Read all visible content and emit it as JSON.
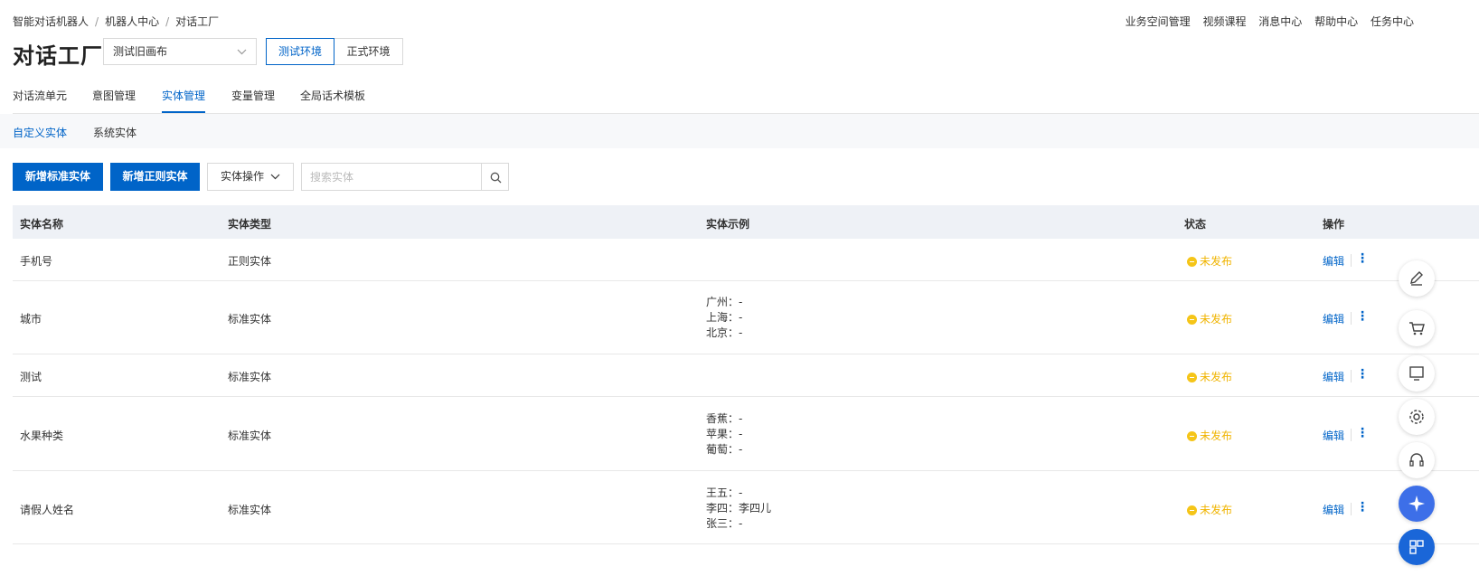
{
  "breadcrumb": [
    "智能对话机器人",
    "机器人中心",
    "对话工厂"
  ],
  "top_links": [
    "业务空间管理",
    "视频课程",
    "消息中心",
    "帮助中心",
    "任务中心"
  ],
  "page_title": "对话工厂",
  "canvas_select": "测试旧画布",
  "env": {
    "test": "测试环境",
    "prod": "正式环境"
  },
  "tabs": [
    "对话流单元",
    "意图管理",
    "实体管理",
    "变量管理",
    "全局话术模板"
  ],
  "active_tab": "实体管理",
  "subtabs": [
    "自定义实体",
    "系统实体"
  ],
  "active_subtab": "自定义实体",
  "toolbar": {
    "add_standard": "新增标准实体",
    "add_regex": "新增正则实体",
    "entity_ops": "实体操作",
    "search_placeholder": "搜索实体"
  },
  "table": {
    "headers": [
      "实体名称",
      "实体类型",
      "实体示例",
      "状态",
      "操作"
    ],
    "edit_label": "编辑",
    "rows": [
      {
        "name": "手机号",
        "type": "正则实体",
        "examples": [],
        "status": "未发布"
      },
      {
        "name": "城市",
        "type": "标准实体",
        "examples": [
          "广州：-",
          "上海：-",
          "北京：-"
        ],
        "status": "未发布"
      },
      {
        "name": "测试",
        "type": "标准实体",
        "examples": [],
        "status": "未发布"
      },
      {
        "name": "水果种类",
        "type": "标准实体",
        "examples": [
          "香蕉：-",
          "苹果：-",
          "葡萄：-"
        ],
        "status": "未发布"
      },
      {
        "name": "请假人姓名",
        "type": "标准实体",
        "examples": [
          "王五：-",
          "李四：李四儿",
          "张三：-"
        ],
        "status": "未发布"
      }
    ]
  },
  "colors": {
    "primary": "#0064c8",
    "status_pending": "#f5c518",
    "header_bg": "#eef1f6"
  }
}
